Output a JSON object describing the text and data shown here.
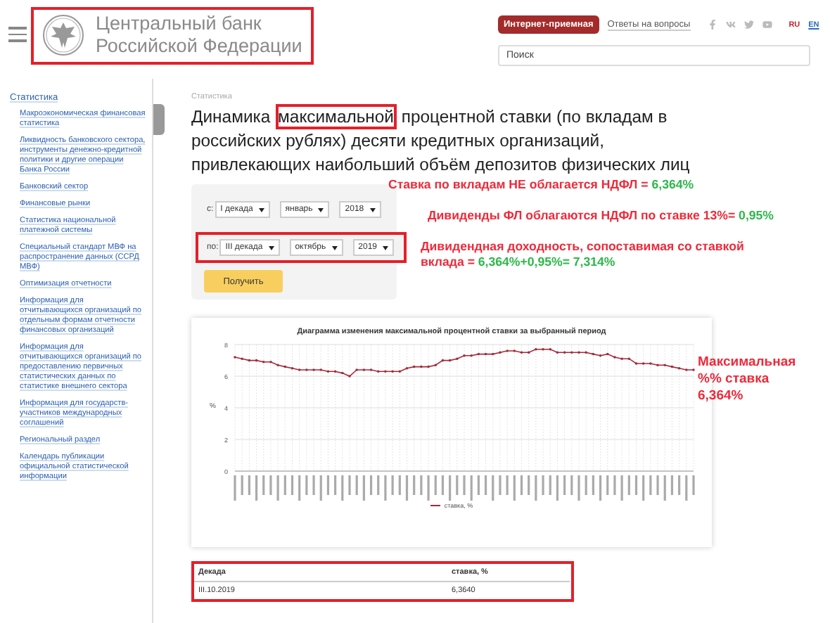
{
  "header": {
    "logo": {
      "lines": [
        "Центральный банк",
        "Российской Федерации"
      ],
      "boxed": true
    },
    "reception_button": "Интернет-приемная",
    "faq_link": "Ответы на вопросы",
    "languages": [
      {
        "label": "RU",
        "selected": true
      },
      {
        "label": "EN",
        "selected": false
      }
    ],
    "search": {
      "placeholder": "Поиск"
    }
  },
  "sidebar": {
    "title": "Статистика",
    "items": [
      "Макроэкономическая финансовая статистика",
      "Ликвидность банковского сектора, инструменты денежно-кредитной политики и другие операции Банка России",
      "Банковский сектор",
      "Финансовые рынки",
      "Статистика национальной платежной системы",
      "Специальный стандарт МВФ на распространение данных (ССРД МВФ)",
      "Оптимизация отчетности",
      "Информация для отчитывающихся организаций по отдельным формам отчетности финансовых организаций",
      "Информация для отчитывающихся организаций по предоставлению первичных статистических данных по статистике внешнего сектора",
      "Информация для государств-участников международных соглашений",
      "Региональный раздел",
      "Календарь публикации официальной статистической информации"
    ]
  },
  "breadcrumb": "Статистика",
  "title": [
    {
      "text": "Динамика ",
      "boxed": false
    },
    {
      "text": "максимальной",
      "boxed": true
    },
    {
      "text": " процентной ставки (по вкладам в российских рублях) десяти кредитных организаций, привлекающих наибольший объём депозитов физических лиц",
      "boxed": false
    }
  ],
  "form": {
    "rows": [
      {
        "label": "с:",
        "boxed": false,
        "selects": [
          "I декада",
          "январь",
          "2018"
        ]
      },
      {
        "label": "по:",
        "boxed": true,
        "selects": [
          "III декада",
          "октябрь",
          "2019"
        ]
      }
    ],
    "submit": "Получить"
  },
  "notes": [
    [
      {
        "text": "Ставка по вкладам НЕ облагается НДФЛ = ",
        "color": "#ee2a3a"
      },
      {
        "text": "6,364%",
        "color": "#2cb84a"
      }
    ],
    [
      {
        "text": "Дивиденды ФЛ облагаются НДФЛ по ставке 13%= ",
        "color": "#ee2a3a"
      },
      {
        "text": "0,95%",
        "color": "#2cb84a"
      }
    ],
    [
      {
        "text": "Дивидендная доходность, сопоставимая со ставкой вклада = ",
        "color": "#ee2a3a"
      },
      {
        "text": "6,364%+0,95%= 7,314%",
        "color": "#2cb84a"
      }
    ]
  ],
  "chart": {
    "chart_data": {
      "type": "line",
      "title": "Диаграмма изменения максимальной процентной ставки за выбранный период",
      "ylabel": "%",
      "ylim": [
        0,
        8
      ],
      "grid": true,
      "yticks": [
        0,
        2,
        4,
        6,
        8
      ],
      "series": [
        {
          "name": "ставка, %",
          "color": "#a52a3a",
          "values": [
            7.2,
            7.1,
            7.0,
            7.0,
            6.9,
            6.9,
            6.7,
            6.6,
            6.5,
            6.4,
            6.4,
            6.4,
            6.4,
            6.3,
            6.3,
            6.2,
            6.0,
            6.4,
            6.4,
            6.4,
            6.3,
            6.3,
            6.3,
            6.3,
            6.5,
            6.6,
            6.6,
            6.6,
            6.7,
            7.0,
            7.0,
            7.1,
            7.3,
            7.3,
            7.4,
            7.4,
            7.4,
            7.5,
            7.6,
            7.6,
            7.5,
            7.5,
            7.7,
            7.7,
            7.7,
            7.5,
            7.5,
            7.5,
            7.5,
            7.5,
            7.4,
            7.3,
            7.4,
            7.2,
            7.1,
            7.1,
            6.8,
            6.8,
            6.8,
            6.7,
            6.7,
            6.6,
            6.5,
            6.4,
            6.4
          ]
        }
      ]
    },
    "note": [
      {
        "text": "Максимальная %% ставка 6,364%",
        "color": "#ee2a3a"
      }
    ]
  },
  "table": {
    "boxed": true,
    "columns": [
      "Декада",
      "ставка, %"
    ],
    "rows": [
      [
        "III.10.2019",
        "6,3640"
      ]
    ]
  }
}
